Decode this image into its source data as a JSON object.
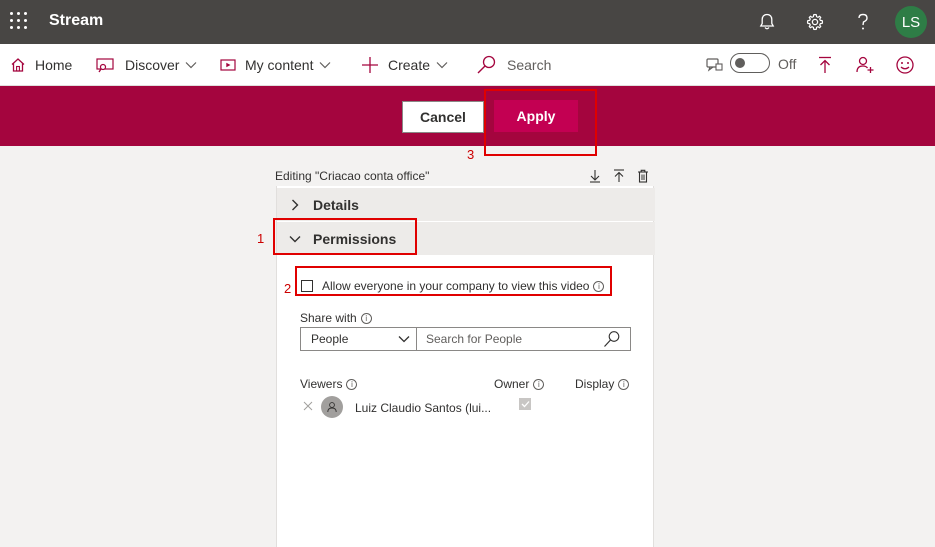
{
  "topbar": {
    "app_name": "Stream",
    "avatar_initials": "LS",
    "icons": [
      "waffle-icon",
      "bell-icon",
      "gear-icon",
      "help-icon"
    ],
    "colors": {
      "background": "#484644",
      "avatar": "#2e7d46"
    }
  },
  "nav": {
    "home": "Home",
    "discover": "Discover",
    "my_content": "My content",
    "create": "Create",
    "search": "Search",
    "toggle_label": "Off",
    "icons": [
      "home-icon",
      "discover-icon",
      "my-content-icon",
      "plus-icon",
      "search-icon",
      "chat-icon",
      "toggle-switch",
      "upload-icon",
      "add-person-icon",
      "smiley-icon"
    ]
  },
  "actions": {
    "cancel": "Cancel",
    "apply": "Apply",
    "colors": {
      "bar": "#a4053e",
      "apply": "#c30052"
    }
  },
  "annotations": {
    "n1": "1",
    "n2": "2",
    "n3": "3"
  },
  "editing": {
    "title": "Editing \"Criacao conta office\"",
    "icons": [
      "download-icon",
      "upload-icon",
      "trash-icon"
    ]
  },
  "sections": {
    "details": "Details",
    "permissions": "Permissions"
  },
  "permissions": {
    "allow_everyone": "Allow everyone in your company to view this video",
    "allow_everyone_checked": false,
    "share_with_label": "Share with",
    "share_with_value": "People",
    "people_search_placeholder": "Search for People",
    "columns": {
      "viewers": "Viewers",
      "owner": "Owner",
      "display": "Display"
    },
    "viewers": [
      {
        "name": "Luiz Claudio Santos (lui...",
        "owner": true
      }
    ]
  }
}
